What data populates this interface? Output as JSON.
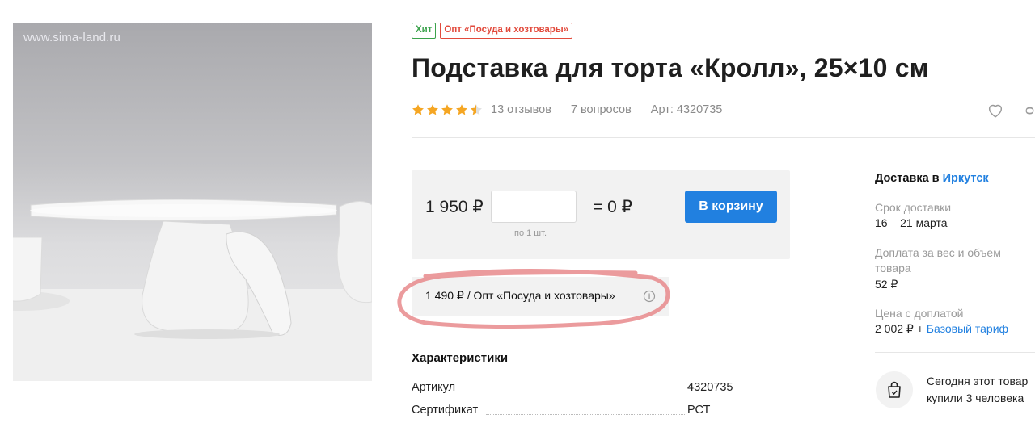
{
  "photo": {
    "watermark": "www.sima-land.ru"
  },
  "badges": {
    "hit": "Хит",
    "opt": "Опт «Посуда и хозтовары»"
  },
  "product": {
    "title": "Подставка для торта «Кролл», 25×10 см",
    "rating": 4.5,
    "reviews": "13 отзывов",
    "questions": "7 вопросов",
    "article": "Арт: 4320735"
  },
  "purchase": {
    "price": "1 950 ₽",
    "qty_value": "",
    "qty_hint": "по 1 шт.",
    "total": "= 0 ₽",
    "cart_label": "В корзину"
  },
  "wholesale": {
    "text": "1 490 ₽ / Опт «Посуда и хозтовары»"
  },
  "characteristics": {
    "title": "Характеристики",
    "rows": [
      {
        "key": "Артикул",
        "value": "4320735"
      },
      {
        "key": "Сертификат",
        "value": "РСТ"
      }
    ]
  },
  "delivery": {
    "head": "Доставка в",
    "city": "Иркутск",
    "term_label": "Срок доставки",
    "term_value": "16 – 21 марта",
    "surcharge_label": "Доплата за вес и объем товара",
    "surcharge_value": "52 ₽",
    "total_label": "Цена с доплатой",
    "total_value": "2 002 ₽ +",
    "tariff_link": "Базовый тариф",
    "today_line1": "Сегодня этот товар",
    "today_line2": "купили 3 человека"
  },
  "colors": {
    "accent": "#2180e0",
    "star": "#f5a623",
    "hit": "#3aa24b",
    "opt": "#e24a3c",
    "annotation": "#e8898c"
  }
}
